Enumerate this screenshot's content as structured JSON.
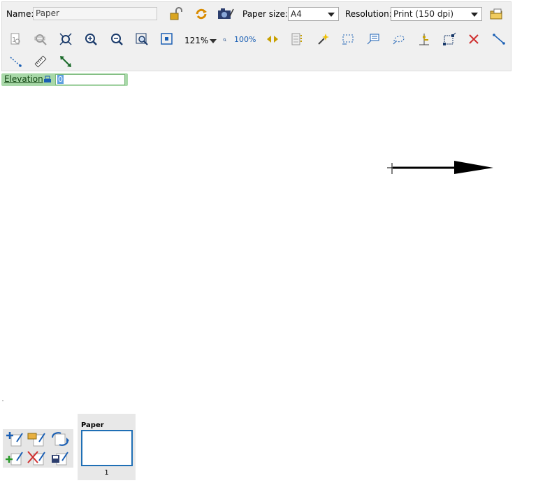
{
  "toolbar": {
    "name_label": "Name:",
    "name_value": "Paper",
    "paper_size_label": "Paper size:",
    "paper_size_value": "A4",
    "resolution_label": "Resolution:",
    "resolution_value": "Print (150 dpi)",
    "zoom_value": "121%",
    "zoom_reset_label": "100%"
  },
  "elevation": {
    "label": "Elevation",
    "value": "0"
  },
  "thumbnail": {
    "name": "Paper",
    "page_number": "1"
  },
  "colors": {
    "toolbar_bg": "#f0f0f0",
    "elevation_bg": "#a8d8a8",
    "thumb_border": "#1f6fb5",
    "accent_blue": "#1a5fb4",
    "delete_red": "#d03030"
  }
}
